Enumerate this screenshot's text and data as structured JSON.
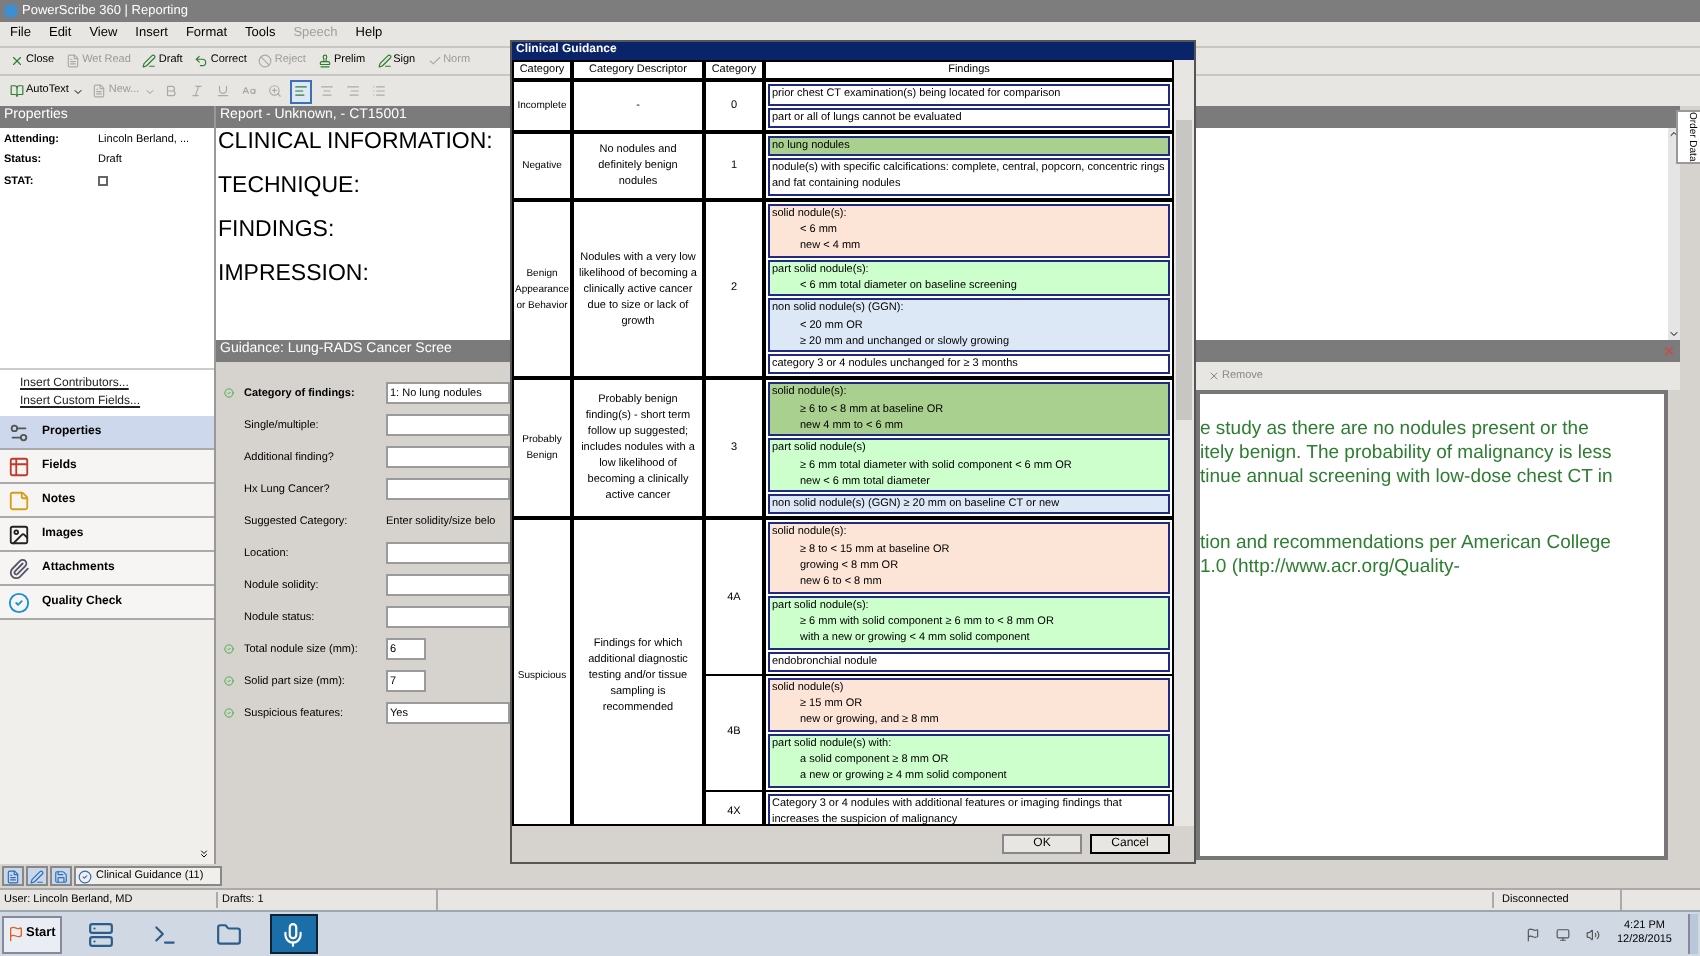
{
  "window": {
    "title": "PowerScribe 360 | Reporting"
  },
  "menu": [
    {
      "label": "File",
      "disabled": false
    },
    {
      "label": "Edit",
      "disabled": false
    },
    {
      "label": "View",
      "disabled": false
    },
    {
      "label": "Insert",
      "disabled": false
    },
    {
      "label": "Format",
      "disabled": false
    },
    {
      "label": "Tools",
      "disabled": false
    },
    {
      "label": "Speech",
      "disabled": true
    },
    {
      "label": "Help",
      "disabled": false
    }
  ],
  "toolbar": [
    {
      "label": "Close",
      "kind": "close",
      "disabled": false
    },
    {
      "label": "Wet Read",
      "kind": "doc",
      "disabled": true
    },
    {
      "label": "Draft",
      "kind": "draft",
      "disabled": false
    },
    {
      "label": "Correct",
      "kind": "correct",
      "disabled": false
    },
    {
      "label": "Reject",
      "kind": "reject",
      "disabled": true
    },
    {
      "label": "Prelim",
      "kind": "prelim",
      "disabled": false
    },
    {
      "label": "Sign",
      "kind": "sign",
      "disabled": false
    },
    {
      "label": "Norm",
      "kind": "check",
      "disabled": true
    }
  ],
  "format_toolbar": [
    {
      "label": "AutoText",
      "kind": "autotext",
      "disabled": false,
      "selected": false
    },
    {
      "label": "New...",
      "kind": "doc",
      "disabled": true,
      "selected": false
    },
    {
      "kind": "bold",
      "disabled": true,
      "selected": false
    },
    {
      "kind": "italic",
      "disabled": true,
      "selected": false
    },
    {
      "kind": "underline",
      "disabled": true,
      "selected": false
    },
    {
      "kind": "case",
      "disabled": true,
      "selected": false
    },
    {
      "kind": "zoom",
      "disabled": true,
      "selected": false
    },
    {
      "kind": "align-left",
      "disabled": false,
      "selected": true
    },
    {
      "kind": "align-center",
      "disabled": true,
      "selected": false
    },
    {
      "kind": "align-right",
      "disabled": true,
      "selected": false
    },
    {
      "kind": "list",
      "disabled": true,
      "selected": false
    }
  ],
  "properties": {
    "title": "Properties",
    "attending_label": "Attending:",
    "attending": "Lincoln Berland, ...",
    "status_label": "Status:",
    "status": "Draft",
    "stat_label": "STAT:",
    "stat_checked": false,
    "links": [
      "Insert Contributors...",
      "Insert Custom Fields..."
    ],
    "nav": [
      {
        "label": "Properties",
        "kind": "properties",
        "selected": true
      },
      {
        "label": "Fields",
        "kind": "fields",
        "selected": false
      },
      {
        "label": "Notes",
        "kind": "notes",
        "selected": false
      },
      {
        "label": "Images",
        "kind": "images",
        "selected": false
      },
      {
        "label": "Attachments",
        "kind": "attachments",
        "selected": false
      },
      {
        "label": "Quality Check",
        "kind": "quality",
        "selected": false
      }
    ]
  },
  "report": {
    "title": "Report - Unknown, - CT15001",
    "sections": [
      "CLINICAL INFORMATION:",
      "TECHNIQUE:",
      "FINDINGS:",
      "IMPRESSION:"
    ]
  },
  "guidance": {
    "title": "Guidance: Lung-RADS Cancer Scree",
    "remove": "Remove",
    "fields": [
      {
        "label": "Category of findings:",
        "kind": "wide",
        "value": "1: No lung nodules",
        "valid": true
      },
      {
        "label": "Single/multiple:",
        "kind": "wide",
        "valid": false
      },
      {
        "label": "Additional finding?",
        "kind": "wide",
        "valid": false
      },
      {
        "label": "Hx Lung Cancer?",
        "kind": "wide",
        "valid": false
      },
      {
        "label": "Suggested Category:",
        "kind": "static",
        "value": "Enter solidity/size belo",
        "valid": false
      },
      {
        "label": "Location:",
        "kind": "wide",
        "valid": false
      },
      {
        "label": "Nodule solidity:",
        "kind": "wide",
        "valid": false
      },
      {
        "label": "Nodule status:",
        "kind": "wide",
        "valid": false
      },
      {
        "label": "Total nodule size (mm):",
        "kind": "short",
        "value": "6",
        "valid": true
      },
      {
        "label": "Solid part size (mm):",
        "kind": "short",
        "value": "7",
        "valid": true
      },
      {
        "label": "Suspicious features:",
        "kind": "wide",
        "value": "Yes",
        "valid": true
      }
    ],
    "recommendation": [
      [
        "e study as there are no nodules present or the",
        "itely benign.  The probability of malignancy is less",
        "tinue annual screening with low-dose chest CT in"
      ],
      [
        "tion and recommendations per American College",
        "1.0 (http://www.acr.org/Quality-"
      ]
    ]
  },
  "order_tab": "Order Data",
  "dialog": {
    "title": "Clinical Guidance",
    "columns": [
      "Category",
      "Category Descriptor",
      "Category",
      "Findings"
    ],
    "rows": [
      {
        "category": "Incomplete",
        "descriptor": "-",
        "levels": [
          {
            "code": "0",
            "findings": [
              {
                "text": "prior chest CT examination(s) being located for comparison",
                "color": "#ffffff"
              },
              {
                "text": "part or all of lungs cannot be evaluated",
                "color": "#ffffff"
              }
            ]
          }
        ]
      },
      {
        "category": "Negative",
        "descriptor": "No nodules and definitely benign nodules",
        "levels": [
          {
            "code": "1",
            "findings": [
              {
                "text": "no lung nodules",
                "color": "#a9d08e"
              },
              {
                "text": "nodule(s) with specific calcifications: complete, central, popcorn, concentric rings and fat containing nodules",
                "color": "#ffffff"
              }
            ]
          }
        ]
      },
      {
        "category": "Benign Appearance or Behavior",
        "descriptor": "Nodules with a very low likelihood of becoming a clinically active cancer due to size or lack of growth",
        "levels": [
          {
            "code": "2",
            "findings": [
              {
                "text": "solid nodule(s):",
                "color": "#fce4d6",
                "children": [
                  "< 6 mm",
                  "new < 4 mm"
                ]
              },
              {
                "text": "part solid nodule(s):",
                "color": "#ccffcc",
                "children": [
                  "< 6 mm total diameter on baseline screening"
                ]
              },
              {
                "text": "non solid nodule(s) (GGN):",
                "color": "#dde8f6",
                "children": [
                  "< 20 mm OR",
                  "≥ 20 mm and unchanged or slowly growing"
                ]
              },
              {
                "text": "category 3 or 4 nodules unchanged for ≥ 3 months",
                "color": "#ffffff"
              }
            ]
          }
        ]
      },
      {
        "category": "Probably Benign",
        "descriptor": "Probably benign finding(s) - short term follow up suggested; includes nodules with a low likelihood of becoming a clinically active cancer",
        "levels": [
          {
            "code": "3",
            "findings": [
              {
                "text": "solid nodule(s):",
                "color": "#a9d08e",
                "children": [
                  "≥ 6 to < 8 mm at baseline  OR",
                  "new 4 mm to < 6 mm"
                ]
              },
              {
                "text": "part solid nodule(s)",
                "color": "#ccffcc",
                "children": [
                  "≥ 6 mm total diameter with solid component < 6 mm OR",
                  "new < 6 mm total diameter"
                ]
              },
              {
                "text": "non solid nodule(s) (GGN) ≥ 20 mm on baseline CT or new",
                "color": "#dde8f6"
              }
            ]
          }
        ]
      },
      {
        "category": "Suspicious",
        "descriptor": "Findings for which additional diagnostic testing and/or tissue sampling is recommended",
        "levels": [
          {
            "code": "4A",
            "findings": [
              {
                "text": "solid nodule(s):",
                "color": "#fce4d6",
                "children": [
                  "≥ 8 to < 15 mm at baseline OR",
                  "growing < 8 mm OR",
                  "new 6 to < 8 mm"
                ]
              },
              {
                "text": "part solid nodule(s):",
                "color": "#ccffcc",
                "children": [
                  "≥ 6 mm with solid component ≥ 6 mm to < 8 mm OR",
                  "with a new or growing < 4 mm solid component"
                ]
              },
              {
                "text": "endobronchial nodule",
                "color": "#ffffff"
              }
            ]
          },
          {
            "code": "4B",
            "findings": [
              {
                "text": "solid nodule(s)",
                "color": "#fce4d6",
                "children": [
                  "≥ 15 mm OR",
                  "new or growing, and ≥ 8 mm"
                ]
              },
              {
                "text": "part solid nodule(s) with:",
                "color": "#ccffcc",
                "children": [
                  "a solid component ≥ 8 mm OR",
                  "a new or growing ≥ 4 mm solid component"
                ]
              }
            ]
          },
          {
            "code": "4X",
            "findings": [
              {
                "text": "Category 3 or 4 nodules with additional features or imaging findings that increases the suspicion of malignancy",
                "color": "#ffffff"
              }
            ]
          }
        ]
      }
    ],
    "buttons": [
      "OK",
      "Cancel"
    ]
  },
  "bottom_tabs": [
    {
      "kind": "page",
      "selected": false
    },
    {
      "kind": "pen",
      "selected": false
    },
    {
      "kind": "save",
      "selected": false
    },
    {
      "label": "Clinical Guidance (11)",
      "kind": "guidance",
      "selected": true
    }
  ],
  "status_bar": {
    "user": "User: Lincoln Berland, MD",
    "drafts": "Drafts: 1",
    "connection": "Disconnected"
  },
  "taskbar": {
    "start": "Start",
    "apps": [
      {
        "kind": "server",
        "selected": false
      },
      {
        "kind": "shell",
        "selected": false
      },
      {
        "kind": "folder",
        "selected": false
      },
      {
        "kind": "mic",
        "selected": true
      }
    ],
    "time": "4:21 PM",
    "date": "12/28/2015"
  }
}
